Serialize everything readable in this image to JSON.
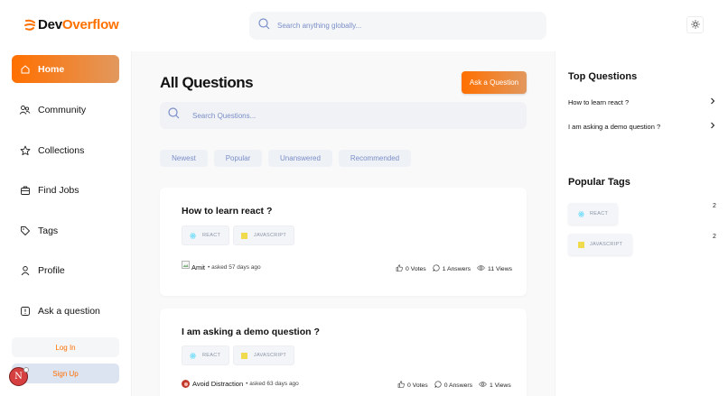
{
  "header": {
    "logo_part1": "Dev",
    "logo_part2": "Overflow",
    "search_placeholder": "Search anything globally..."
  },
  "sidebar": {
    "items": [
      {
        "label": "Home",
        "icon": "home-icon",
        "active": true
      },
      {
        "label": "Community",
        "icon": "users-icon"
      },
      {
        "label": "Collections",
        "icon": "star-icon"
      },
      {
        "label": "Find Jobs",
        "icon": "briefcase-icon"
      },
      {
        "label": "Tags",
        "icon": "tag-icon"
      },
      {
        "label": "Profile",
        "icon": "user-icon"
      },
      {
        "label": "Ask a question",
        "icon": "question-icon"
      }
    ],
    "login_label": "Log In",
    "signup_label": "Sign Up",
    "avatar_letter": "N"
  },
  "main": {
    "title": "All Questions",
    "ask_button": "Ask a Question",
    "search_placeholder": "Search Questions...",
    "filters": [
      "Newest",
      "Popular",
      "Unanswered",
      "Recommended"
    ],
    "questions": [
      {
        "title": "How to learn react ?",
        "tags": [
          "REACT",
          "JAVASCRIPT"
        ],
        "author": "Amit",
        "asked": "• asked 57 days ago",
        "votes": "0 Votes",
        "answers": "1 Answers",
        "views": "11 Views"
      },
      {
        "title": "I am asking a demo question ?",
        "tags": [
          "REACT",
          "JAVASCRIPT"
        ],
        "author": "Avoid Distraction",
        "asked": "• asked 63 days ago",
        "votes": "0 Votes",
        "answers": "0 Answers",
        "views": "1 Views"
      }
    ]
  },
  "right": {
    "top_questions_heading": "Top Questions",
    "top_questions": [
      "How to learn react ?",
      "I am asking a demo question ?"
    ],
    "popular_tags_heading": "Popular Tags",
    "popular_tags": [
      {
        "name": "REACT",
        "count": "2"
      },
      {
        "name": "JAVASCRIPT",
        "count": "2"
      }
    ]
  },
  "colors": {
    "accent": "#ff7000",
    "accent_light": "#e2985e",
    "muted_blue": "#7b8ec8"
  }
}
